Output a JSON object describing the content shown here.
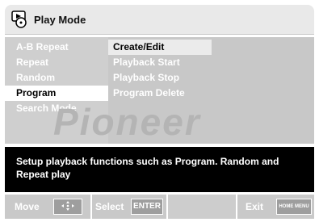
{
  "header": {
    "title": "Play Mode",
    "icon": "play-mode-icon"
  },
  "menu": {
    "items": [
      {
        "label": "A-B Repeat",
        "selected": false
      },
      {
        "label": "Repeat",
        "selected": false
      },
      {
        "label": "Random",
        "selected": false
      },
      {
        "label": "Program",
        "selected": true
      },
      {
        "label": "Search Mode",
        "selected": false
      }
    ],
    "subitems": [
      {
        "label": "Create/Edit",
        "selected": true
      },
      {
        "label": "Playback Start",
        "selected": false
      },
      {
        "label": "Playback Stop",
        "selected": false
      },
      {
        "label": "Program Delete",
        "selected": false
      }
    ]
  },
  "watermark": "Pioneer",
  "help": {
    "text": "Setup playback functions such as Program. Random and Repeat play"
  },
  "footer": {
    "move_label": "Move",
    "select_label": "Select",
    "select_key": "ENTER",
    "exit_label": "Exit",
    "exit_key": "HOME MENU"
  },
  "colors": {
    "panel": "#cfcfcf",
    "highlight": "#ffffff",
    "helpbox": "#000000"
  }
}
